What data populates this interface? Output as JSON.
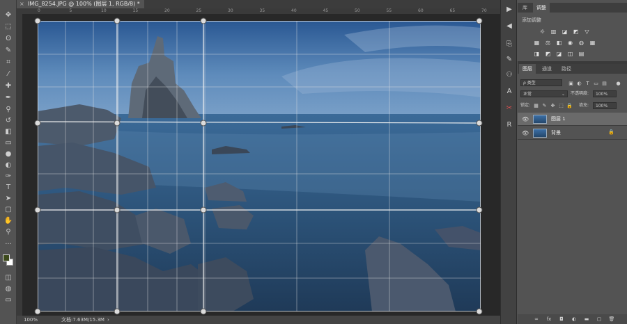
{
  "document": {
    "tab_title": "IMG_8254.JPG @ 100% (图层 1, RGB/8) *",
    "close_glyph": "×"
  },
  "ruler": {
    "ticks": [
      "0",
      "5",
      "10",
      "15",
      "20",
      "25",
      "30",
      "35",
      "40",
      "45",
      "50",
      "55",
      "60",
      "65",
      "70"
    ]
  },
  "status": {
    "zoom": "100%",
    "doc_size": "文档:7.63M/15.3M",
    "arrow": "›"
  },
  "tools": [
    {
      "name": "move-tool-icon",
      "glyph": "✥"
    },
    {
      "name": "marquee-tool-icon",
      "glyph": "⬚"
    },
    {
      "name": "lasso-tool-icon",
      "glyph": "ʘ"
    },
    {
      "name": "quick-select-tool-icon",
      "glyph": "✎"
    },
    {
      "name": "crop-tool-icon",
      "glyph": "⌗"
    },
    {
      "name": "eyedropper-tool-icon",
      "glyph": "⁄"
    },
    {
      "name": "healing-brush-tool-icon",
      "glyph": "✚"
    },
    {
      "name": "brush-tool-icon",
      "glyph": "✒"
    },
    {
      "name": "stamp-tool-icon",
      "glyph": "⚲"
    },
    {
      "name": "history-brush-tool-icon",
      "glyph": "↺"
    },
    {
      "name": "eraser-tool-icon",
      "glyph": "◧"
    },
    {
      "name": "gradient-tool-icon",
      "glyph": "▭"
    },
    {
      "name": "blur-tool-icon",
      "glyph": "●"
    },
    {
      "name": "dodge-tool-icon",
      "glyph": "◐"
    },
    {
      "name": "pen-tool-icon",
      "glyph": "✑"
    },
    {
      "name": "type-tool-icon",
      "glyph": "T"
    },
    {
      "name": "path-select-tool-icon",
      "glyph": "➤"
    },
    {
      "name": "shape-tool-icon",
      "glyph": "▢"
    },
    {
      "name": "hand-tool-icon",
      "glyph": "✋"
    },
    {
      "name": "zoom-tool-icon",
      "glyph": "⚲"
    },
    {
      "name": "more-tools-icon",
      "glyph": "···"
    }
  ],
  "swatches": {
    "foreground": "#3d4a1c",
    "background": "#ffffff"
  },
  "mid_icons": [
    {
      "name": "play-icon",
      "glyph": "▶"
    },
    {
      "name": "collapse-icon",
      "glyph": "◀"
    },
    {
      "name": "history-icon",
      "glyph": "⎘"
    },
    {
      "name": "brush-settings-icon",
      "glyph": "✎"
    },
    {
      "name": "clone-source-icon",
      "glyph": "⚇"
    },
    {
      "name": "character-icon",
      "glyph": "A"
    },
    {
      "name": "tools-preset-icon",
      "glyph": "✂"
    },
    {
      "name": "paragraph-icon",
      "glyph": "R"
    }
  ],
  "panel_top": {
    "tabs": [
      "库",
      "调整"
    ],
    "active_tab": 1,
    "add_adjustment": "添加调整",
    "row1": [
      "☼",
      "▥",
      "◪",
      "◩",
      "▽"
    ],
    "row2": [
      "▦",
      "⚖",
      "◧",
      "◉",
      "◍",
      "▦"
    ],
    "row3": [
      "◨",
      "◩",
      "◪",
      "◫",
      "▤"
    ]
  },
  "layers_panel": {
    "tabs": [
      "图层",
      "通道",
      "路径"
    ],
    "active_tab": 0,
    "filter_placeholder": "ρ 类型",
    "blend_mode": "正常",
    "opacity_label": "不透明度:",
    "opacity_value": "100%",
    "lock_label": "锁定:",
    "fill_label": "填充:",
    "fill_value": "100%",
    "layers": [
      {
        "name": "图层 1",
        "selected": true,
        "locked": false
      },
      {
        "name": "背景",
        "selected": false,
        "locked": true
      }
    ],
    "footer_icons": [
      "∞",
      "fx",
      "◘",
      "◐",
      "▬",
      "▢",
      "🗑"
    ]
  }
}
